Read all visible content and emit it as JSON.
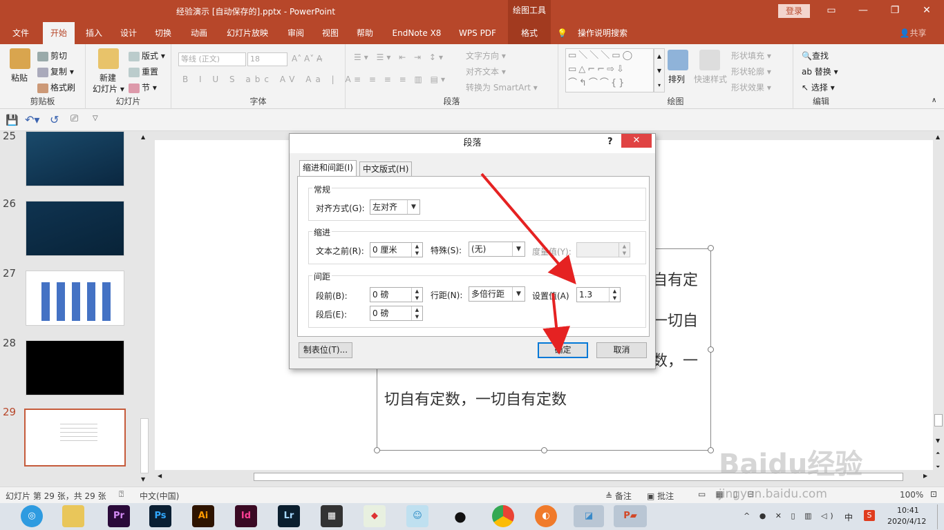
{
  "window": {
    "title": "经验演示 [自动保存的].pptx  -  PowerPoint",
    "context_tab_group": "绘图工具",
    "login": "登录"
  },
  "tabs": [
    "文件",
    "开始",
    "插入",
    "设计",
    "切换",
    "动画",
    "幻灯片放映",
    "审阅",
    "视图",
    "帮助",
    "EndNote X8",
    "WPS PDF",
    "格式"
  ],
  "tell_me": "操作说明搜索",
  "share": "共享",
  "ribbon": {
    "clipboard": {
      "name": "剪贴板",
      "paste": "粘贴",
      "cut": "剪切",
      "copy": "复制",
      "format_painter": "格式刷"
    },
    "slides": {
      "name": "幻灯片",
      "new_slide": "新建",
      "new_slide2": "幻灯片",
      "layout": "版式",
      "reset": "重置",
      "section": "节"
    },
    "font": {
      "name": "字体",
      "font_name": "等线 (正文)",
      "font_size": "18"
    },
    "paragraph": {
      "name": "段落",
      "text_direction": "文字方向",
      "align_text": "对齐文本",
      "smartart": "转换为 SmartArt"
    },
    "drawing": {
      "name": "绘图",
      "arrange": "排列",
      "quick_styles": "快速样式",
      "shape_fill": "形状填充",
      "shape_outline": "形状轮廓",
      "shape_effects": "形状效果"
    },
    "editing": {
      "name": "编辑",
      "find": "查找",
      "replace": "替换",
      "select": "选择"
    }
  },
  "thumbnails": [
    {
      "num": "25",
      "style": "dark-blue"
    },
    {
      "num": "26",
      "style": "dark-navy"
    },
    {
      "num": "27",
      "style": "white-grid"
    },
    {
      "num": "28",
      "style": "black"
    },
    {
      "num": "29",
      "style": "white-text",
      "selected": true
    }
  ],
  "slide_text": {
    "line1_end": "自有定",
    "line2_end": "一切自",
    "line3_end": "数，一",
    "line4": "切自有定数，一切自有定数"
  },
  "dialog": {
    "title": "段落",
    "help": "?",
    "close": "✕",
    "tab_indent": "缩进和间距(I)",
    "tab_chinese": "中文版式(H)",
    "general": {
      "legend": "常规",
      "align_label": "对齐方式(G):",
      "align_value": "左对齐"
    },
    "indent": {
      "legend": "缩进",
      "before_label": "文本之前(R):",
      "before_value": "0 厘米",
      "special_label": "特殊(S):",
      "special_value": "(无)",
      "by_label": "度量值(Y):",
      "by_value": ""
    },
    "spacing": {
      "legend": "间距",
      "before_label": "段前(B):",
      "before_value": "0 磅",
      "line_label": "行距(N):",
      "line_value": "多倍行距",
      "at_label": "设置值(A)",
      "at_value": "1.3",
      "after_label": "段后(E):",
      "after_value": "0 磅"
    },
    "tabs_button": "制表位(T)...",
    "ok": "确定",
    "cancel": "取消"
  },
  "status": {
    "slide_info": "幻灯片 第 29 张，共 29 张",
    "language": "中文(中国)",
    "notes": "备注",
    "comments": "批注",
    "zoom": "100%"
  },
  "taskbar": {
    "time": "10:41",
    "date": "2020/4/12",
    "ime": "中"
  },
  "watermark": {
    "logo": "Baidu经验",
    "url": "jingyan.baidu.com"
  },
  "colors": {
    "accent": "#b7472a",
    "arrow": "#e52222",
    "default_btn": "#0078d7"
  }
}
